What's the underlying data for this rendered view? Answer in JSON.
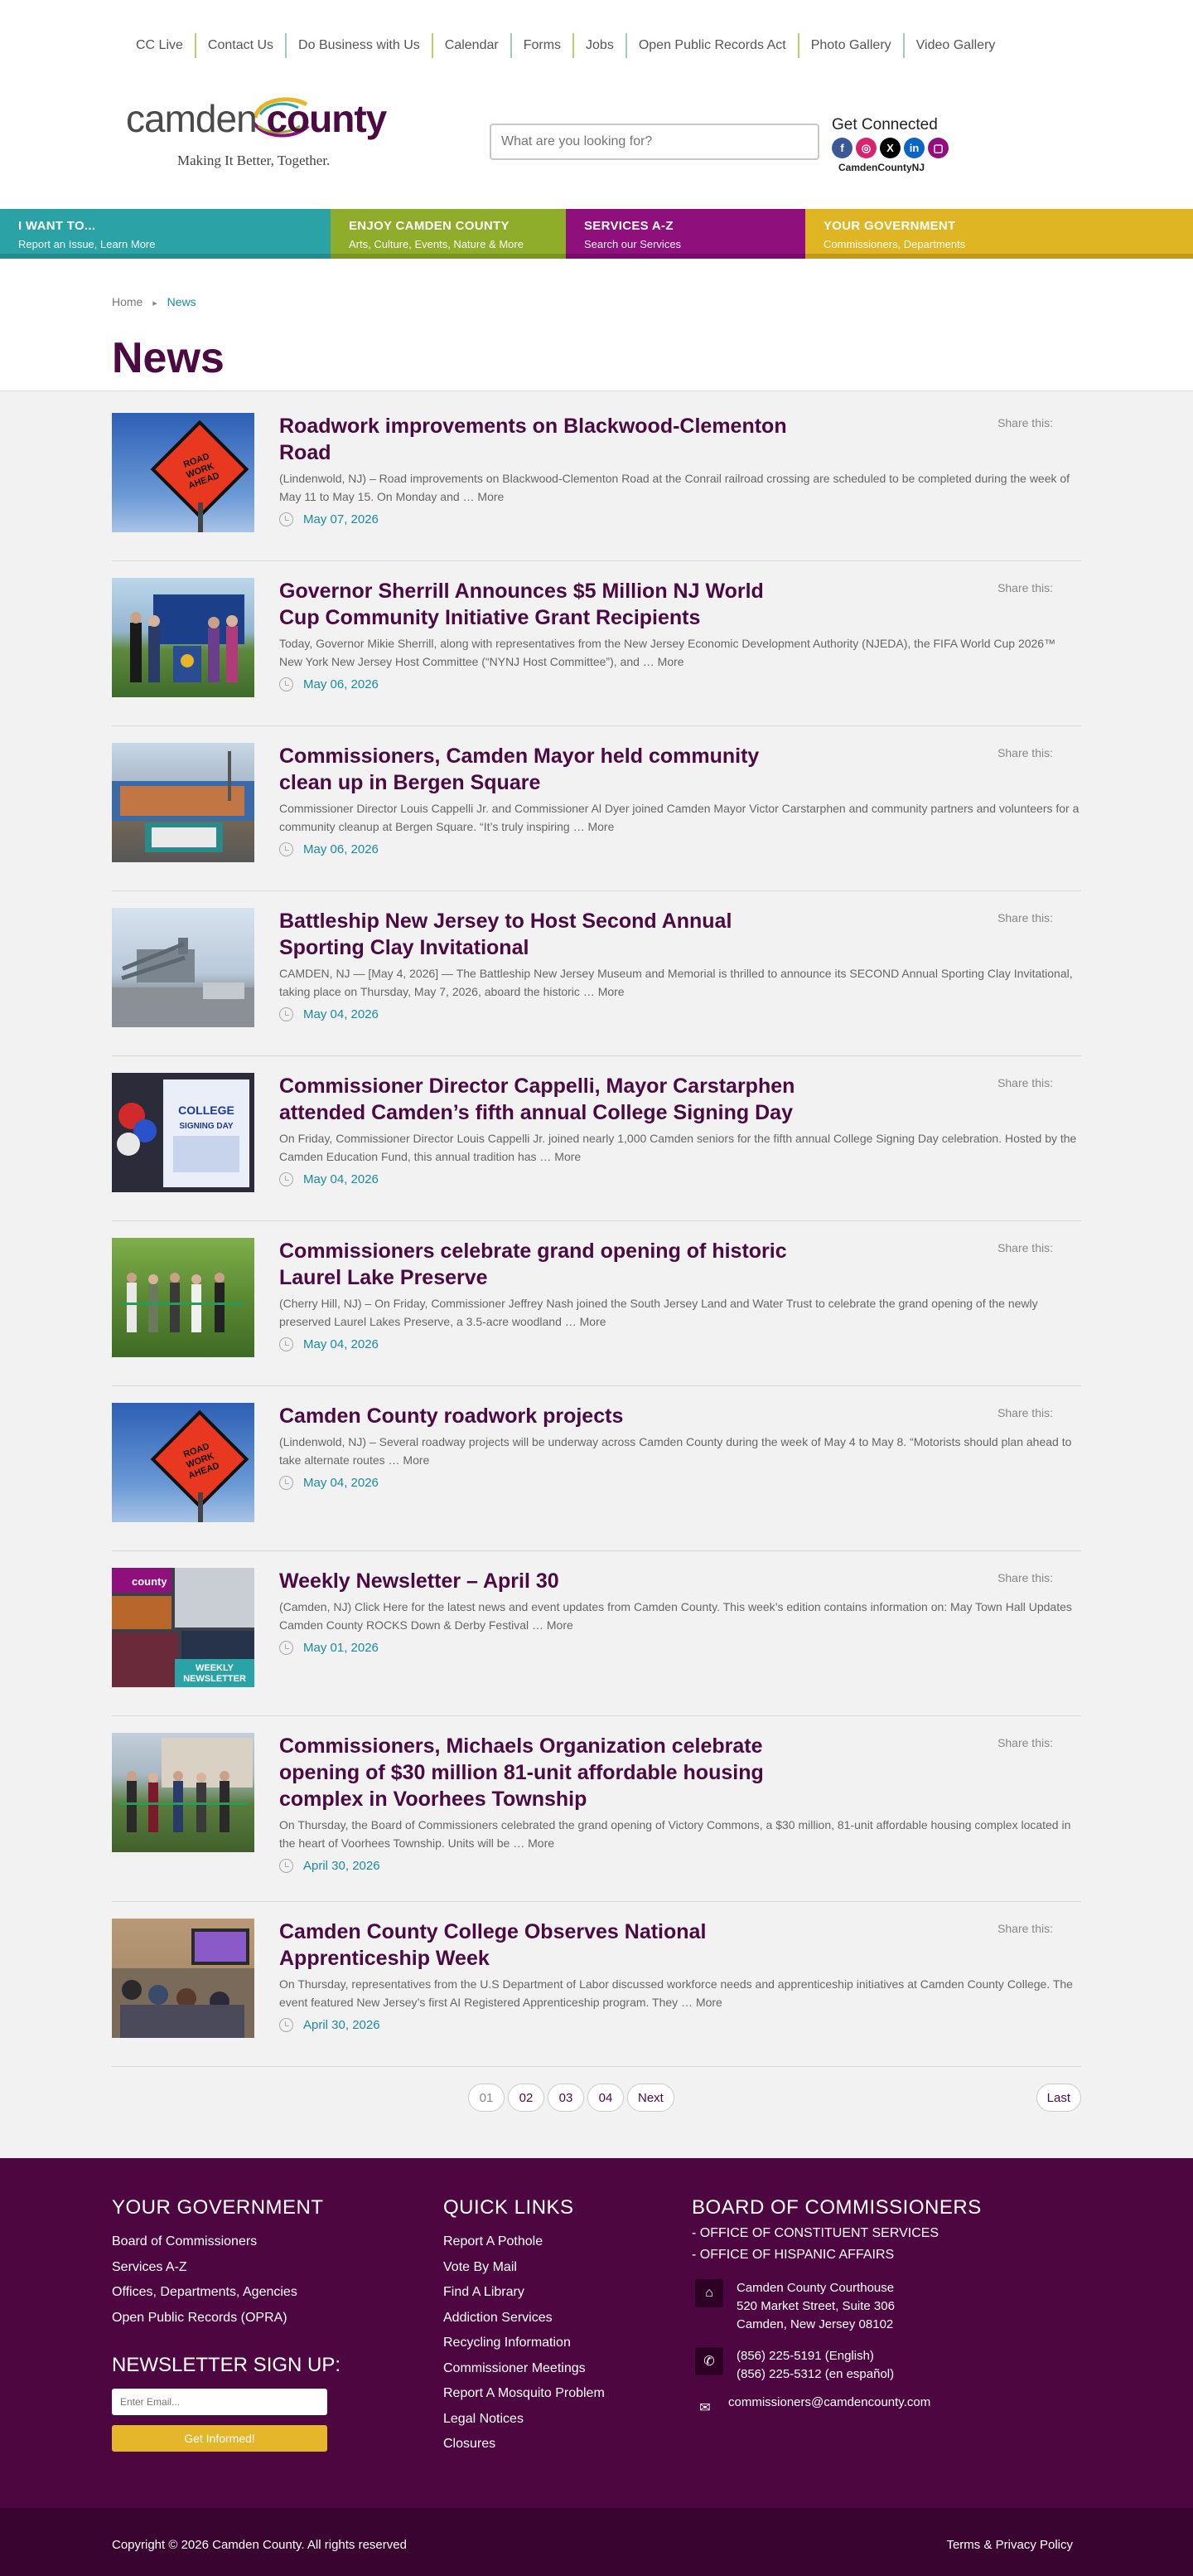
{
  "utility_nav": [
    "CC Live",
    "Contact Us",
    "Do Business with Us",
    "Calendar",
    "Forms",
    "Jobs",
    "Open Public Records Act",
    "Photo Gallery",
    "Video Gallery"
  ],
  "logo": {
    "word_left": "camden",
    "word_right": "county",
    "tagline": "Making It Better, Together."
  },
  "search": {
    "placeholder": "What are you looking for?"
  },
  "connect": {
    "title": "Get Connected",
    "handle": "CamdenCountyNJ",
    "icons": [
      "facebook-icon",
      "instagram-icon",
      "x-icon",
      "linkedin-icon",
      "podcast-icon"
    ]
  },
  "main_nav": [
    {
      "title": "I WANT TO...",
      "sub": "Report an Issue, Learn More",
      "color": "#2ba3a6"
    },
    {
      "title": "ENJOY CAMDEN COUNTY",
      "sub": "Arts, Culture, Events, Nature & More",
      "color": "#8fad2b"
    },
    {
      "title": "SERVICES A-Z",
      "sub": "Search our Services",
      "color": "#8f0f7d"
    },
    {
      "title": "YOUR GOVERNMENT",
      "sub": "Commissioners, Departments",
      "color": "#e0b524"
    }
  ],
  "breadcrumb": {
    "home": "Home",
    "current": "News"
  },
  "page_title": "News",
  "share_label": "Share this:",
  "articles": [
    {
      "title": "Roadwork improvements on Blackwood-Clementon Road",
      "excerpt": "(Lindenwold, NJ) – Road improvements on Blackwood-Clementon Road at the Conrail railroad crossing are scheduled to be completed during the week of May 11 to May 15. On Monday and … More",
      "date": "May 07, 2026",
      "image": "road-work-sign"
    },
    {
      "title": "Governor Sherrill Announces $5 Million NJ World Cup Community Initiative Grant Recipients",
      "excerpt": "Today, Governor Mikie Sherrill, along with representatives from the New Jersey Economic Development Authority (NJEDA), the FIFA World Cup 2026™ New York New Jersey Host Committee (“NYNJ Host Committee”), and … More",
      "date": "May 06, 2026",
      "image": "podium-group"
    },
    {
      "title": "Commissioners, Camden Mayor held community clean up in Bergen Square",
      "excerpt": "Commissioner Director Louis Cappelli Jr. and Commissioner Al Dyer joined Camden Mayor Victor Carstarphen and community partners and volunteers for a community cleanup at Bergen Square.   “It’s truly inspiring … More",
      "date": "May 06, 2026",
      "image": "crowd-banner"
    },
    {
      "title": "Battleship New Jersey to Host Second Annual Sporting Clay Invitational",
      "excerpt": "CAMDEN, NJ — [May 4, 2026] — The Battleship New Jersey Museum and Memorial is thrilled to announce its SECOND Annual Sporting Clay Invitational, taking place on Thursday, May 7, 2026, aboard the historic … More",
      "date": "May 04, 2026",
      "image": "battleship"
    },
    {
      "title": "Commissioner Director Cappelli, Mayor Carstarphen attended Camden’s fifth annual College Signing Day",
      "excerpt": "On Friday, Commissioner Director Louis Cappelli Jr. joined nearly 1,000 Camden seniors for the fifth annual College Signing Day celebration. Hosted by the Camden Education Fund, this annual tradition has … More",
      "date": "May 04, 2026",
      "image": "signing-day"
    },
    {
      "title": "Commissioners celebrate grand opening of historic Laurel Lake Preserve",
      "excerpt": "(Cherry Hill, NJ) – On Friday, Commissioner Jeffrey Nash joined the South Jersey Land and Water Trust to celebrate the grand opening of the newly preserved Laurel Lakes Preserve, a 3.5-acre woodland … More",
      "date": "May 04, 2026",
      "image": "ribbon-woods"
    },
    {
      "title": "Camden County roadwork projects",
      "excerpt": "(Lindenwold, NJ) – Several roadway projects will be underway across Camden County during the week of May 4 to May 8.   “Motorists should plan ahead to take alternate routes … More",
      "date": "May 04, 2026",
      "image": "road-work-sign"
    },
    {
      "title": "Weekly Newsletter – April 30",
      "excerpt": "(Camden, NJ) Click Here for the latest news and event updates from Camden County. This week’s edition contains information on: May Town Hall Updates Camden County ROCKS Down & Derby Festival … More",
      "date": "May 01, 2026",
      "image": "newsletter"
    },
    {
      "title": "Commissioners, Michaels Organization celebrate opening of $30 million 81-unit affordable housing complex in Voorhees Township",
      "excerpt": "On Thursday, the Board of Commissioners celebrated the grand opening of Victory Commons, a $30 million, 81-unit affordable housing complex located in the heart of Voorhees Township. Units will be … More",
      "date": "April 30, 2026",
      "image": "ribbon-building"
    },
    {
      "title": "Camden County College Observes National Apprenticeship Week",
      "excerpt": "On Thursday, representatives from the U.S Department of Labor discussed workforce needs and apprenticeship initiatives at Camden County College. The event featured New Jersey’s first AI Registered Apprenticeship program. They … More",
      "date": "April 30, 2026",
      "image": "classroom"
    }
  ],
  "thumb_text": {
    "road_sign": "ROAD WORK AHEAD",
    "signing": "COLLEGE SIGNING DAY",
    "newsletter_brand": "county",
    "newsletter_label": "WEEKLY NEWSLETTER"
  },
  "pagination": {
    "pages": [
      "01",
      "02",
      "03",
      "04"
    ],
    "next": "Next",
    "last": "Last",
    "current": "01"
  },
  "footer": {
    "gov_title": "YOUR GOVERNMENT",
    "gov_links": [
      "Board of Commissioners",
      "Services A-Z",
      "Offices, Departments, Agencies",
      "Open Public Records (OPRA)"
    ],
    "quick_title": "QUICK LINKS",
    "quick_links": [
      "Report A Pothole",
      "Vote By Mail",
      "Find A Library",
      "Addiction Services",
      "Recycling Information",
      "Commissioner Meetings",
      "Report A Mosquito Problem",
      "Legal Notices",
      "Closures"
    ],
    "board_title": "BOARD OF COMMISSIONERS",
    "board_sub": [
      "- OFFICE OF CONSTITUENT SERVICES",
      "- OFFICE OF HISPANIC AFFAIRS"
    ],
    "address": [
      "Camden County Courthouse",
      "520 Market Street, Suite 306",
      "Camden, New Jersey 08102"
    ],
    "phones": [
      "(856) 225-5191 (English)",
      "(856) 225-5312 (en español)"
    ],
    "email": "commissioners@camdencounty.com",
    "newsletter_title": "NEWSLETTER SIGN UP:",
    "newsletter_placeholder": "Enter Email...",
    "newsletter_button": "Get Informed!"
  },
  "copyright": {
    "text": "Copyright © 2026 Camden County. All rights reserved",
    "terms": "Terms & Privacy Policy"
  }
}
